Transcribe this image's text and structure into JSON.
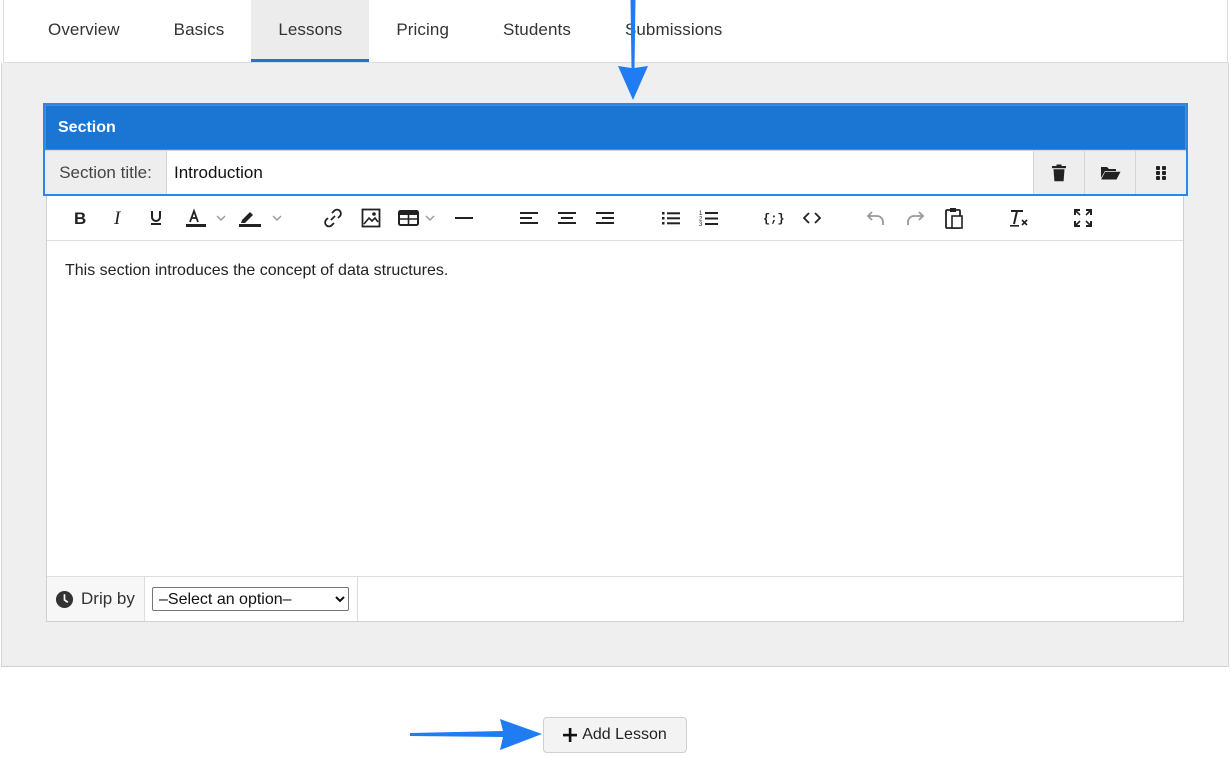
{
  "tabs": [
    {
      "label": "Overview"
    },
    {
      "label": "Basics"
    },
    {
      "label": "Lessons",
      "active": true
    },
    {
      "label": "Pricing"
    },
    {
      "label": "Students"
    },
    {
      "label": "Submissions"
    }
  ],
  "section": {
    "header": "Section",
    "title_label": "Section title:",
    "title_value": "Introduction",
    "actions": [
      "trash-icon",
      "folder-open-icon",
      "drag-handle-icon"
    ]
  },
  "editor": {
    "content": "This section introduces the concept of data structures.",
    "toolbar": [
      "bold",
      "italic",
      "underline",
      "text-color",
      "highlight-color",
      "link",
      "image",
      "table",
      "horizontal-rule",
      "align-left",
      "align-center",
      "align-right",
      "bullet-list",
      "numbered-list",
      "code-sample",
      "source-code",
      "undo",
      "redo",
      "paste",
      "clear-formatting",
      "fullscreen"
    ]
  },
  "drip": {
    "label": "Drip by",
    "selected": "–Select an option–"
  },
  "add_lesson": {
    "label": "Add Lesson"
  },
  "colors": {
    "accent": "#1a76d2",
    "arrow": "#1f7cf2"
  }
}
